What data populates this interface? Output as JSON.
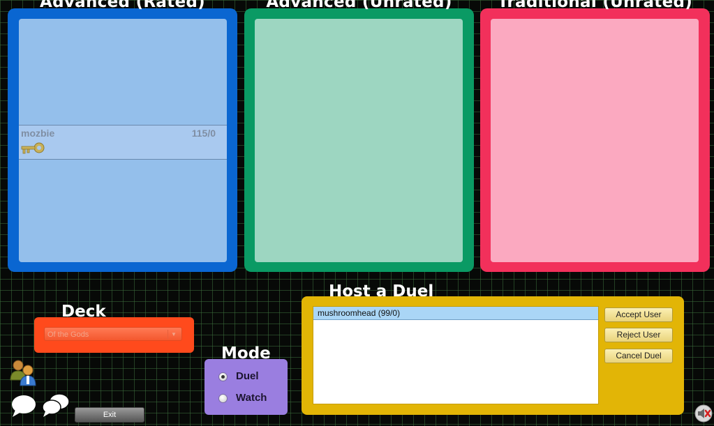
{
  "lobbies": [
    {
      "title": "Advanced (Rated)",
      "users": [
        {
          "name": "mozbie",
          "rating": "115/0",
          "icon": "key-icon"
        }
      ]
    },
    {
      "title": "Advanced (Unrated)",
      "users": []
    },
    {
      "title": "Traditional (Unrated)",
      "users": []
    }
  ],
  "deck": {
    "label": "Deck",
    "selected": "Of the Gods"
  },
  "mode": {
    "label": "Mode",
    "options": [
      "Duel",
      "Watch"
    ],
    "selected": "Duel"
  },
  "host": {
    "label": "Host a Duel",
    "requests": [
      "mushroomhead (99/0)"
    ],
    "accept_label": "Accept User",
    "reject_label": "Reject User",
    "cancel_label": "Cancel Duel"
  },
  "footer": {
    "exit_label": "Exit",
    "icons": [
      "users-icon",
      "chat-icon",
      "group-chat-icon",
      "sound-muted-icon"
    ]
  },
  "colors": {
    "rated": "#0a66d1",
    "advanced_unrated": "#0a9a64",
    "traditional": "#f2305b",
    "deck": "#ff4a1c",
    "mode": "#9a7ee0",
    "host": "#e2b506"
  }
}
